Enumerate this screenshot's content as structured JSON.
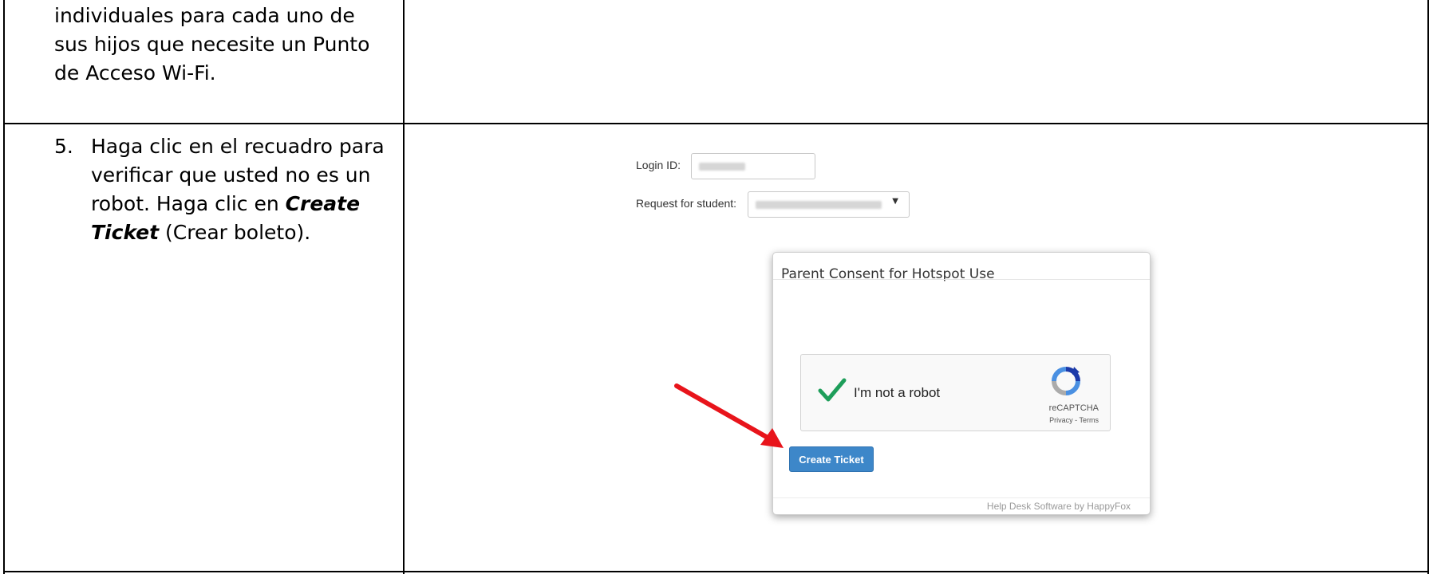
{
  "row1": {
    "lines": [
      "individuales para cada uno de",
      "sus hijos que necesite un Punto",
      "de Acceso Wi-Fi."
    ]
  },
  "row2": {
    "number": "5.",
    "line1": "Haga clic en el recuadro para",
    "line2": "verificar que usted no es un",
    "line3_pre": "robot. Haga clic en ",
    "line3_bold": "Create",
    "line4_bold": "Ticket",
    "line4_post": " (Crear boleto)."
  },
  "form": {
    "login_label": "Login ID:",
    "student_label": "Request for student:"
  },
  "modal": {
    "title": "Parent Consent for Hotspot Use",
    "captcha_label": "I'm not a robot",
    "recaptcha_brand": "reCAPTCHA",
    "recaptcha_links": "Privacy - Terms",
    "button_label": "Create Ticket",
    "footer": "Help Desk Software by HappyFox"
  },
  "colors": {
    "button": "#3d87c9",
    "arrow": "#e8141b",
    "check": "#1e9e5a"
  }
}
